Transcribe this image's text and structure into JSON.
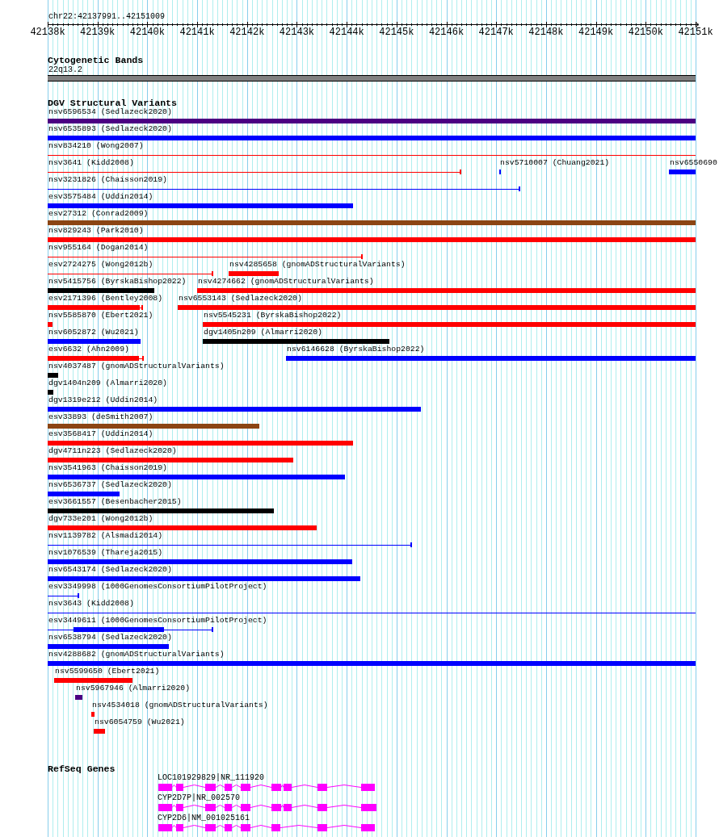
{
  "ruler": {
    "location": "chr22:42137991..42151009",
    "tick_labels": [
      "42138k",
      "42139k",
      "42140k",
      "42141k",
      "42142k",
      "42143k",
      "42144k",
      "42145k",
      "42146k",
      "42147k",
      "42148k",
      "42149k",
      "42150k",
      "42151k"
    ]
  },
  "cytogenetic_bands": {
    "title": "Cytogenetic Bands",
    "band": {
      "label": "22q13.2"
    }
  },
  "dgv_structural_variants": {
    "title": "DGV Structural Variants",
    "rows": [
      {
        "features": [
          {
            "label": "nsv6596534 (Sedlazeck2020)",
            "kind": "bar",
            "color": "#4b0082"
          }
        ]
      },
      {
        "features": [
          {
            "label": "nsv6535893 (Sedlazeck2020)",
            "kind": "bar",
            "color": "#0000ff"
          }
        ]
      },
      {
        "features": [
          {
            "label": "nsv834210 (Wong2007)",
            "kind": "line",
            "color": "#ff0000"
          }
        ]
      },
      {
        "features": [
          {
            "label": "nsv3641 (Kidd2008)",
            "kind": "line",
            "color": "#ff0000"
          },
          {
            "label": "nsv5710007 (Chuang2021)",
            "kind": "bar",
            "color": "#0000ff"
          },
          {
            "label": "nsv6550690",
            "kind": "bar",
            "color": "#0000ff"
          }
        ]
      },
      {
        "features": [
          {
            "label": "nsv3231826 (Chaisson2019)",
            "kind": "line",
            "color": "#0000ff"
          }
        ]
      },
      {
        "features": [
          {
            "label": "esv3575484 (Uddin2014)",
            "kind": "bar",
            "color": "#0000ff"
          }
        ]
      },
      {
        "features": [
          {
            "label": "esv27312 (Conrad2009)",
            "kind": "bar",
            "color": "#8b4513"
          }
        ]
      },
      {
        "features": [
          {
            "label": "nsv829243 (Park2010)",
            "kind": "bar",
            "color": "#ff0000"
          }
        ]
      },
      {
        "features": [
          {
            "label": "nsv955164 (Dogan2014)",
            "kind": "line",
            "color": "#ff0000"
          }
        ]
      },
      {
        "features": [
          {
            "label": "esv2724275 (Wong2012b)",
            "kind": "line",
            "color": "#ff0000"
          },
          {
            "label": "nsv4285658 (gnomADStructuralVariants)",
            "kind": "bar",
            "color": "#ff0000"
          }
        ]
      },
      {
        "features": [
          {
            "label": "nsv5415756 (ByrskaBishop2022)",
            "kind": "bar",
            "color": "#000000"
          },
          {
            "label": "nsv4274662 (gnomADStructuralVariants)",
            "kind": "bar",
            "color": "#ff0000"
          }
        ]
      },
      {
        "features": [
          {
            "label": "esv2171396 (Bentley2008)",
            "kind": "bar-with-line",
            "color": "#ff0000"
          },
          {
            "label": "nsv6553143 (Sedlazeck2020)",
            "kind": "bar",
            "color": "#ff0000"
          }
        ]
      },
      {
        "features": [
          {
            "label": "nsv5585870 (Ebert2021)",
            "kind": "bar",
            "color": "#ff0000"
          },
          {
            "label": "nsv5545231 (ByrskaBishop2022)",
            "kind": "bar",
            "color": "#ff0000"
          }
        ]
      },
      {
        "features": [
          {
            "label": "nsv6052872 (Wu2021)",
            "kind": "bar",
            "color": "#0000ff"
          },
          {
            "label": "dgv1405n209 (Almarri2020)",
            "kind": "bar",
            "color": "#000000"
          }
        ]
      },
      {
        "features": [
          {
            "label": "esv6632 (Ahn2009)",
            "kind": "bar-with-line",
            "color": "#ff0000"
          },
          {
            "label": "nsv6146628 (ByrskaBishop2022)",
            "kind": "bar",
            "color": "#0000ff"
          }
        ]
      },
      {
        "features": [
          {
            "label": "nsv4037487 (gnomADStructuralVariants)",
            "kind": "bar",
            "color": "#000000"
          }
        ]
      },
      {
        "features": [
          {
            "label": "dgv1404n209 (Almarri2020)",
            "kind": "bar",
            "color": "#000000"
          }
        ]
      },
      {
        "features": [
          {
            "label": "dgv1319e212 (Uddin2014)",
            "kind": "bar",
            "color": "#0000ff"
          }
        ]
      },
      {
        "features": [
          {
            "label": "esv33893 (deSmith2007)",
            "kind": "bar",
            "color": "#8b4513"
          }
        ]
      },
      {
        "features": [
          {
            "label": "esv3568417 (Uddin2014)",
            "kind": "bar",
            "color": "#ff0000"
          }
        ]
      },
      {
        "features": [
          {
            "label": "dgv4711n223 (Sedlazeck2020)",
            "kind": "bar",
            "color": "#ff0000"
          }
        ]
      },
      {
        "features": [
          {
            "label": "nsv3541963 (Chaisson2019)",
            "kind": "bar",
            "color": "#0000ff"
          }
        ]
      },
      {
        "features": [
          {
            "label": "nsv6536737 (Sedlazeck2020)",
            "kind": "bar",
            "color": "#0000ff"
          }
        ]
      },
      {
        "features": [
          {
            "label": "esv3661557 (Besenbacher2015)",
            "kind": "bar",
            "color": "#000000"
          }
        ]
      },
      {
        "features": [
          {
            "label": "dgv733e201 (Wong2012b)",
            "kind": "bar",
            "color": "#ff0000"
          }
        ]
      },
      {
        "features": [
          {
            "label": "nsv1139782 (Alsmadi2014)",
            "kind": "line",
            "color": "#0000ff"
          }
        ]
      },
      {
        "features": [
          {
            "label": "nsv1076539 (Thareja2015)",
            "kind": "bar",
            "color": "#0000ff"
          }
        ]
      },
      {
        "features": [
          {
            "label": "nsv6543174 (Sedlazeck2020)",
            "kind": "bar",
            "color": "#0000ff"
          }
        ]
      },
      {
        "features": [
          {
            "label": "esv3349998 (1000GenomesConsortiumPilotProject)",
            "kind": "line",
            "color": "#0000ff"
          }
        ]
      },
      {
        "features": [
          {
            "label": "nsv3643 (Kidd2008)",
            "kind": "line",
            "color": "#0000ff"
          }
        ]
      },
      {
        "features": [
          {
            "label": "esv3449611 (1000GenomesConsortiumPilotProject)",
            "kind": "bar-with-line",
            "color": "#0000ff"
          }
        ]
      },
      {
        "features": [
          {
            "label": "nsv6538794 (Sedlazeck2020)",
            "kind": "bar",
            "color": "#0000ff"
          }
        ]
      },
      {
        "features": [
          {
            "label": "nsv4288682 (gnomADStructuralVariants)",
            "kind": "bar",
            "color": "#0000ff"
          }
        ]
      },
      {
        "features": [
          {
            "label": "nsv5599650 (Ebert2021)",
            "kind": "bar",
            "color": "#ff0000"
          }
        ]
      },
      {
        "features": [
          {
            "label": "nsv5967946 (Almarri2020)",
            "kind": "bar",
            "color": "#4b0082"
          }
        ]
      },
      {
        "features": [
          {
            "label": "nsv4534018 (gnomADStructuralVariants)",
            "kind": "bar",
            "color": "#ff0000"
          }
        ]
      },
      {
        "features": [
          {
            "label": "nsv6054759 (Wu2021)",
            "kind": "bar",
            "color": "#ff0000"
          }
        ]
      }
    ]
  },
  "refseq_genes": {
    "title": "RefSeq Genes",
    "genes": [
      {
        "label": "LOC101929829|NR_111920"
      },
      {
        "label": "CYP2D7P|NR_002570"
      },
      {
        "label": "CYP2D6|NM_001025161"
      }
    ]
  }
}
